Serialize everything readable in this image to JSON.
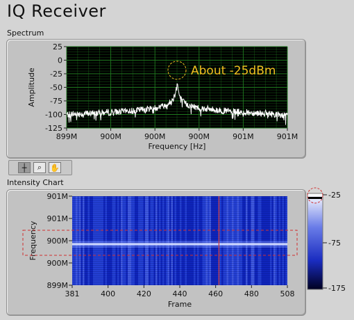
{
  "app": {
    "title": "IQ Receiver"
  },
  "spectrum": {
    "section_label": "Spectrum",
    "annotation": "About -25dBm"
  },
  "intensity": {
    "section_label": "Intensity Chart"
  },
  "toolbar": {
    "tools": [
      {
        "icon": "crosshair-icon",
        "active": true
      },
      {
        "icon": "zoom-icon",
        "active": false
      },
      {
        "icon": "pan-hand-icon",
        "active": false
      }
    ]
  },
  "colors": {
    "plot_bg": "#000000",
    "grid": "#1f7a1f",
    "trace": "#ffffff",
    "annotation": "#f0c020",
    "intensity_low": "#1530c8",
    "intensity_high": "#ffffff",
    "marker_line": "#d03030"
  },
  "chart_data": [
    {
      "type": "line",
      "title": "",
      "xlabel": "Frequency [Hz]",
      "ylabel": "Amplitude",
      "xlim": [
        899000000,
        901000000
      ],
      "ylim": [
        -125,
        25
      ],
      "x_ticks": [
        "899M",
        "900M",
        "900M",
        "900M",
        "901M",
        "901M"
      ],
      "y_ticks": [
        "25",
        "0",
        "-25",
        "-50",
        "-75",
        "-100",
        "-125"
      ],
      "grid": true,
      "series": [
        {
          "x": [
            899000000,
            899200000,
            899400000,
            899600000,
            899800000,
            899900000,
            899950000,
            899980000,
            900000000,
            900020000,
            900050000,
            900100000,
            900200000,
            900400000,
            900600000,
            900800000,
            901000000
          ],
          "values": [
            -100,
            -98,
            -96,
            -93,
            -88,
            -83,
            -76,
            -65,
            -40,
            -65,
            -76,
            -83,
            -88,
            -93,
            -96,
            -98,
            -102
          ]
        }
      ]
    },
    {
      "type": "heatmap",
      "title": "",
      "xlabel": "Frame",
      "ylabel": "Frequency",
      "xlim": [
        381,
        508
      ],
      "x_ticks": [
        "381",
        "400",
        "420",
        "440",
        "460",
        "480",
        "508"
      ],
      "y_ticks": [
        "901M",
        "901M",
        "900M",
        "900M",
        "899M"
      ],
      "color_scale": {
        "min": -175,
        "max": -25,
        "ticks": [
          "-25",
          "-75",
          "-175"
        ]
      },
      "peak_row_value": -25
    }
  ]
}
